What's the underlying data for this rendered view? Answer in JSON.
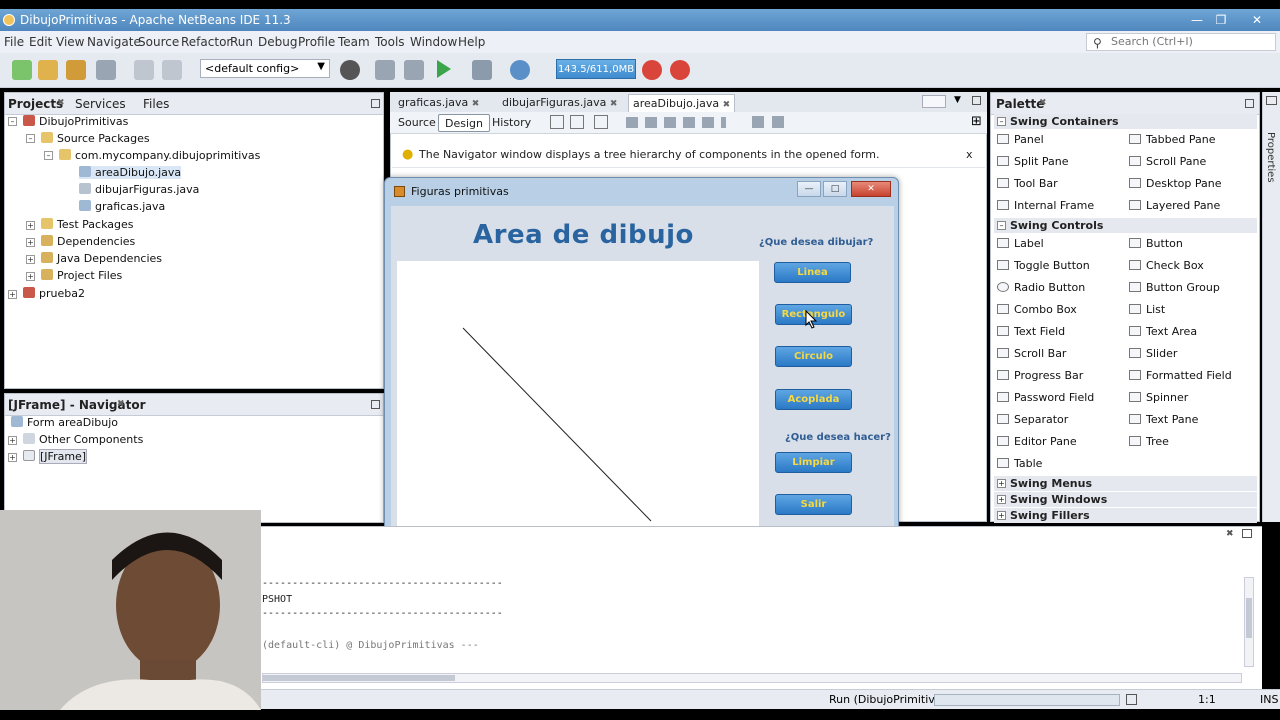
{
  "window": {
    "title": "DibujoPrimitivas - Apache NetBeans IDE 11.3"
  },
  "menu": [
    "File",
    "Edit",
    "View",
    "Navigate",
    "Source",
    "Refactor",
    "Run",
    "Debug",
    "Profile",
    "Team",
    "Tools",
    "Window",
    "Help"
  ],
  "search": {
    "placeholder": "Search (Ctrl+I)"
  },
  "toolbar": {
    "config": "<default config>",
    "memory": "143.5/611,0MB"
  },
  "projects": {
    "tabs": [
      "Projects",
      "Services",
      "Files"
    ],
    "tree": {
      "root": "DibujoPrimitivas",
      "source_packages": "Source Packages",
      "package": "com.mycompany.dibujoprimitivas",
      "files": [
        "areaDibujo.java",
        "dibujarFiguras.java",
        "graficas.java"
      ],
      "test_packages": "Test Packages",
      "dependencies": "Dependencies",
      "java_dependencies": "Java Dependencies",
      "project_files": "Project Files",
      "other_project": "prueba2"
    }
  },
  "navigator": {
    "title": "[JFrame] - Navigator",
    "form": "Form areaDibujo",
    "other": "Other Components",
    "jframe": "[JFrame]"
  },
  "editor": {
    "tabs": [
      "graficas.java",
      "dibujarFiguras.java",
      "areaDibujo.java"
    ],
    "subtabs": [
      "Source",
      "Design",
      "History"
    ],
    "info": "The Navigator window displays a tree hierarchy of components in the opened form.",
    "info_close": "x"
  },
  "form": {
    "title": "Figuras primitivas",
    "heading": "Area de dibujo",
    "q1": "¿Que desea dibujar?",
    "q2": "¿Que desea hacer?",
    "buttons": {
      "linea": "Linea",
      "rect": "Rectangulo",
      "circulo": "Circulo",
      "acoplada": "Acoplada",
      "limpiar": "Limpiar",
      "salir": "Salir"
    }
  },
  "palette": {
    "title": "Palette",
    "cat1": "Swing Containers",
    "containers": [
      "Panel",
      "Tabbed Pane",
      "Split Pane",
      "Scroll Pane",
      "Tool Bar",
      "Desktop Pane",
      "Internal Frame",
      "Layered Pane"
    ],
    "cat2": "Swing Controls",
    "controls": [
      "Label",
      "Button",
      "Toggle Button",
      "Check Box",
      "Radio Button",
      "Button Group",
      "Combo Box",
      "List",
      "Text Field",
      "Text Area",
      "Scroll Bar",
      "Slider",
      "Progress Bar",
      "Formatted Field",
      "Password Field",
      "Spinner",
      "Separator",
      "Text Pane",
      "Editor Pane",
      "Tree",
      "Table"
    ],
    "cat3": "Swing Menus",
    "cat4": "Swing Windows",
    "cat5": "Swing Fillers",
    "side_label": "Properties"
  },
  "output": {
    "line1": "----------------------------------------",
    "line2": "PSHOT",
    "line3": "----------------------------------------",
    "line4": "(default-cli) @ DibujoPrimitivas ---"
  },
  "status": {
    "run": "Run (DibujoPrimitivas)",
    "position": "1:1",
    "mode": "INS"
  }
}
